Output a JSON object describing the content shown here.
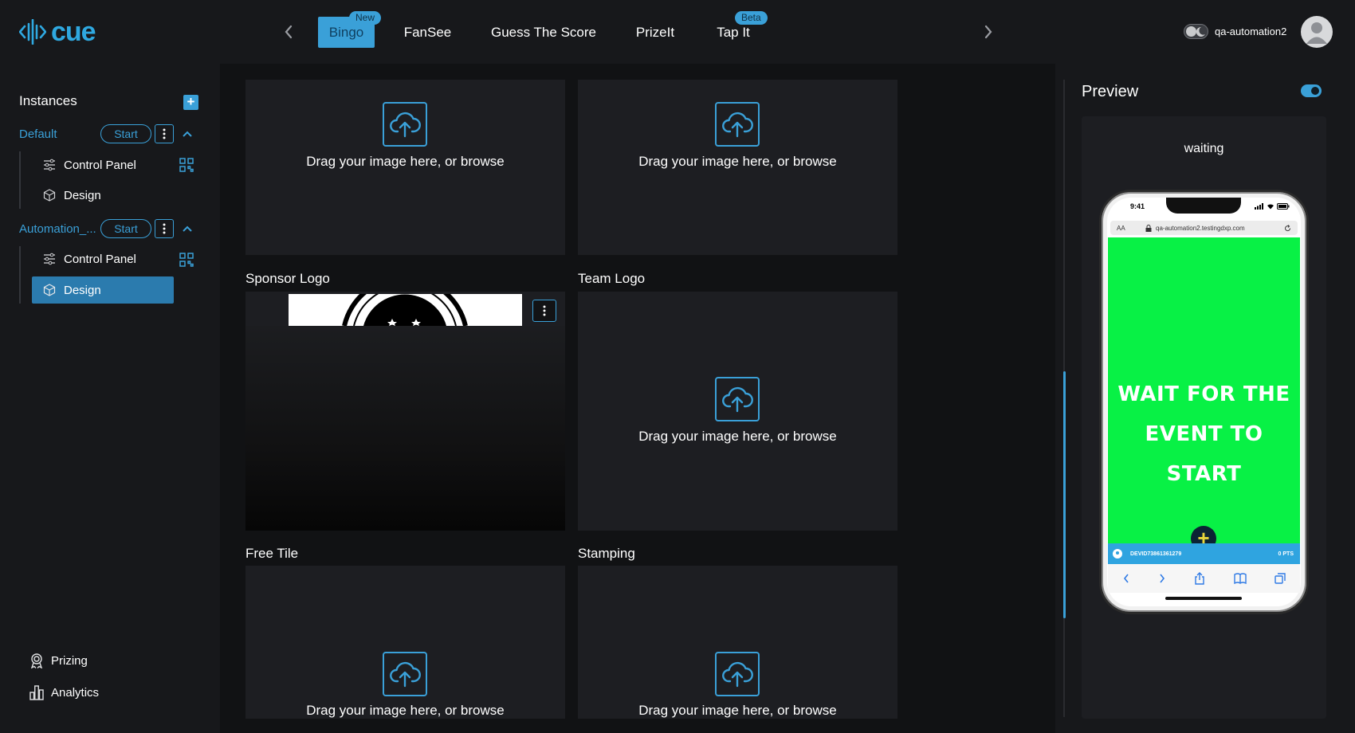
{
  "header": {
    "logo_text": "cue",
    "tabs": [
      {
        "label": "Bingo",
        "badge": "New",
        "active": true
      },
      {
        "label": "FanSee"
      },
      {
        "label": "Guess The Score"
      },
      {
        "label": "PrizeIt"
      },
      {
        "label": "Tap It",
        "badge": "Beta"
      }
    ],
    "username": "qa-automation2"
  },
  "sidebar": {
    "title": "Instances",
    "add_label": "+",
    "instances": [
      {
        "name": "Default",
        "start_label": "Start",
        "items": [
          {
            "label": "Control Panel",
            "icon": "sliders-icon"
          },
          {
            "label": "Design",
            "icon": "cube-icon"
          }
        ]
      },
      {
        "name": "Automation_...",
        "start_label": "Start",
        "items": [
          {
            "label": "Control Panel",
            "icon": "sliders-icon"
          },
          {
            "label": "Design",
            "icon": "cube-icon",
            "active": true
          }
        ]
      }
    ],
    "bottom": [
      {
        "label": "Prizing",
        "icon": "award-icon"
      },
      {
        "label": "Analytics",
        "icon": "chart-icon"
      }
    ]
  },
  "main": {
    "drag_text": "Drag your image here, or browse",
    "sections": {
      "sponsor_logo": "Sponsor Logo",
      "team_logo": "Team Logo",
      "free_tile": "Free Tile",
      "stamping": "Stamping"
    }
  },
  "preview": {
    "title": "Preview",
    "status": "waiting",
    "phone": {
      "time": "9:41",
      "text_size_label": "AA",
      "url": "qa-automation2.testingdxp.com",
      "message_line1": "WAIT FOR THE",
      "message_line2": "EVENT TO START",
      "device_id": "DEVID73861361279",
      "points": "0 PTS",
      "fab_label": "+"
    }
  },
  "colors": {
    "accent": "#3aa0d8",
    "background": "#17181b",
    "panel": "#1d1e22",
    "preview_green": "#08f145"
  }
}
